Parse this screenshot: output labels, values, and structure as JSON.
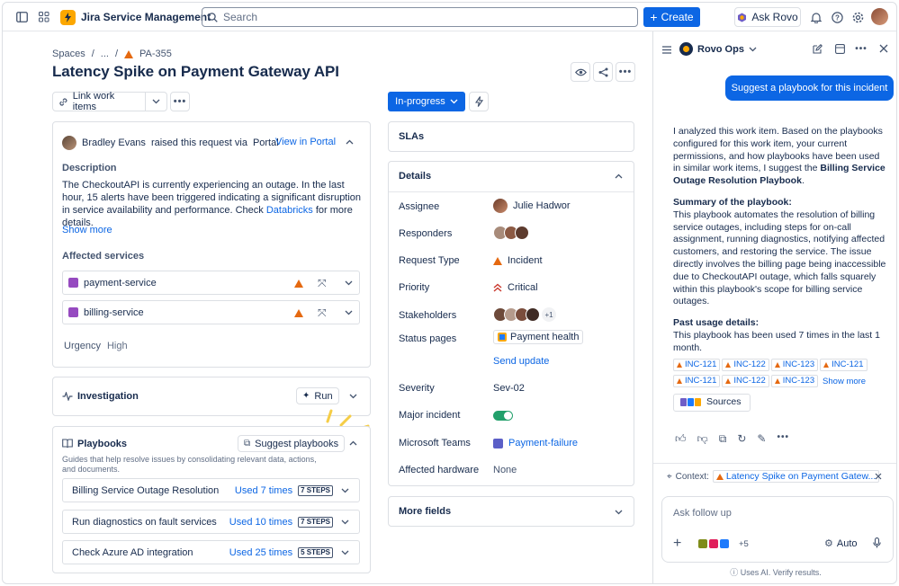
{
  "app": {
    "name": "Jira Service Management"
  },
  "topbar": {
    "search_placeholder": "Search",
    "create_label": "Create",
    "ask_rovo_label": "Ask Rovo"
  },
  "breadcrumb": {
    "spaces": "Spaces",
    "ellipsis": "...",
    "issue_key": "PA-355"
  },
  "issue": {
    "title": "Latency Spike on Payment Gateway API",
    "link_work_items": "Link work items",
    "status": "In-progress"
  },
  "request": {
    "reporter": "Bradley Evans",
    "raised_text": "raised this request via",
    "channel": "Portal",
    "view_portal": "View in Portal",
    "description_label": "Description",
    "description_text": "The CheckoutAPI is currently experiencing an outage. In the last hour, 15 alerts have been triggered indicating a significant disruption in service availability and performance. Check",
    "description_link": "Databricks",
    "description_tail": "for more details.",
    "show_more": "Show more",
    "affected_label": "Affected services",
    "services": [
      "payment-service",
      "billing-service"
    ],
    "urgency_label": "Urgency",
    "urgency_value": "High"
  },
  "investigation": {
    "label": "Investigation",
    "run_label": "Run"
  },
  "playbooks": {
    "label": "Playbooks",
    "suggest_label": "Suggest playbooks",
    "description": "Guides that help resolve issues by consolidating relevant data, actions, and documents.",
    "items": [
      {
        "name": "Billing Service Outage Resolution",
        "used": "Used 7 times",
        "steps": "7 STEPS"
      },
      {
        "name": "Run diagnostics on fault services",
        "used": "Used 10 times",
        "steps": "7 STEPS"
      },
      {
        "name": "Check Azure AD integration",
        "used": "Used 25 times",
        "steps": "5 STEPS"
      }
    ]
  },
  "slas": {
    "label": "SLAs"
  },
  "details": {
    "label": "Details",
    "assignee_label": "Assignee",
    "assignee": "Julie Hadwor",
    "responders_label": "Responders",
    "request_type_label": "Request Type",
    "request_type": "Incident",
    "priority_label": "Priority",
    "priority": "Critical",
    "stakeholders_label": "Stakeholders",
    "stakeholders_more": "+1",
    "status_pages_label": "Status pages",
    "status_page": "Payment health",
    "send_update": "Send update",
    "severity_label": "Severity",
    "severity": "Sev-02",
    "major_incident_label": "Major incident",
    "teams_label": "Microsoft Teams",
    "teams_channel": "Payment-failure",
    "hardware_label": "Affected hardware",
    "hardware": "None"
  },
  "more_fields": {
    "label": "More fields"
  },
  "rovo": {
    "agent_name": "Rovo Ops",
    "user_message": "Suggest a playbook for this incident",
    "reply_intro": "I analyzed this work item. Based on the playbooks configured for this work item, your current permissions, and how playbooks have been used in similar work items, I suggest the",
    "reply_playbook": "Billing Service Outage Resolution Playbook",
    "summary_heading": "Summary of the playbook:",
    "summary_text": "This playbook automates the resolution of billing service outages, including steps for on-call assignment, running diagnostics, notifying affected customers, and restoring the service. The issue directly involves the billing page being inaccessible due to CheckoutAPI outage, which falls squarely within this playbook's scope for billing service outages.",
    "usage_heading": "Past usage details:",
    "usage_text": "This playbook has been used 7 times in the last 1 month.",
    "incidents": [
      "INC-121",
      "INC-122",
      "INC-123",
      "INC-121",
      "INC-121",
      "INC-122",
      "INC-123"
    ],
    "show_more": "Show more",
    "sources_label": "Sources",
    "context_label": "Context:",
    "context_value": "Latency Spike on Payment Gatew...",
    "composer_placeholder": "Ask follow up",
    "connectors_more": "+5",
    "auto_label": "Auto",
    "disclaimer": "Uses AI. Verify results."
  },
  "colors": {
    "primary": "#0c66e4",
    "warning": "#e56910",
    "success": "#22a06b",
    "brand": "#fca700"
  }
}
